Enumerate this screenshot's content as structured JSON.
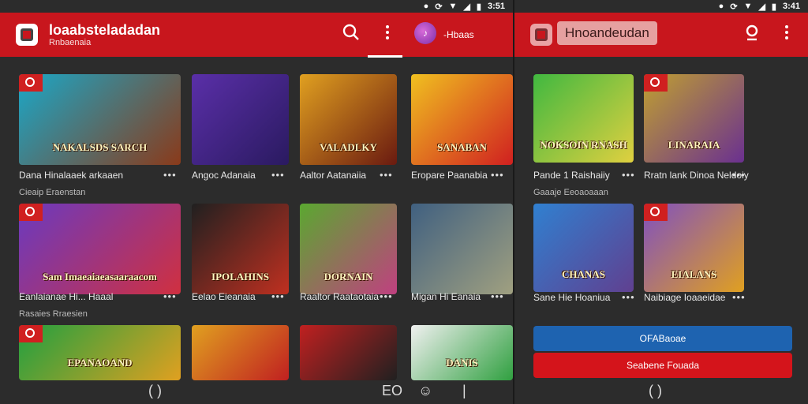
{
  "left": {
    "status": {
      "time": "3:51"
    },
    "header": {
      "title": "loaabsteladadan",
      "subtitle": "Rnbaenaia",
      "user": "-Hbaas"
    },
    "rows": [
      {
        "section": "",
        "items": [
          {
            "title": "NAKALSDS SARCH",
            "caption": "Dana Hinalaaek arkaaen",
            "g1": "#1aa8c8",
            "g2": "#8a3a1a",
            "tag": true
          },
          {
            "title": "",
            "caption": "Angoc Adanaia",
            "g1": "#5a2fa8",
            "g2": "#2a1a60",
            "tag": false
          },
          {
            "title": "VALADLKY",
            "caption": "Aaltor Aatanaiia",
            "g1": "#e0a020",
            "g2": "#6a1a10",
            "tag": false
          },
          {
            "title": "SANABAN",
            "caption": "Eropare Paanabia",
            "g1": "#f0c020",
            "g2": "#d02020",
            "tag": false
          }
        ]
      },
      {
        "section": "Cieaip Eraenstan",
        "items": [
          {
            "title": "Sam Imaeaiaeasaaraacom",
            "caption": "Eanlaianae Hi... Haaal",
            "g1": "#6a3ac0",
            "g2": "#d03040",
            "tag": true
          },
          {
            "title": "IPOLAHINS",
            "caption": "Eelao Eieanaia",
            "g1": "#202020",
            "g2": "#c03020",
            "tag": false
          },
          {
            "title": "DORNAIN",
            "caption": "Raaltor Raataotaia",
            "g1": "#5aa830",
            "g2": "#c04080",
            "tag": false
          },
          {
            "title": "",
            "caption": "Migan Hi Eanaia",
            "g1": "#406080",
            "g2": "#a0a080",
            "tag": false
          }
        ]
      },
      {
        "section": "Rasaies Rraesien",
        "items": [
          {
            "title": "EPANAOAND",
            "caption": "",
            "g1": "#20a040",
            "g2": "#e0a020",
            "tag": true
          },
          {
            "title": "",
            "caption": "",
            "g1": "#e0a020",
            "g2": "#c02020",
            "tag": false
          },
          {
            "title": "",
            "caption": "",
            "g1": "#c02020",
            "g2": "#202020",
            "tag": false
          },
          {
            "title": "DANIS",
            "caption": "",
            "g1": "#f0f0f0",
            "g2": "#30a040",
            "tag": false
          }
        ]
      }
    ]
  },
  "right": {
    "status": {
      "time": "3:41"
    },
    "header": {
      "chip": "Hnoandeudan"
    },
    "rows": [
      {
        "section": "",
        "items": [
          {
            "title": "NOKSOIN RNASH",
            "caption": "Pande 1 Raishaiiy",
            "g1": "#40b840",
            "g2": "#e0d040",
            "tag": false
          },
          {
            "title": "LINARAIA",
            "caption": "Rratn lank Dinoa Neldoiy",
            "g1": "#c0a030",
            "g2": "#6a3090",
            "tag": true
          }
        ]
      },
      {
        "section": "Gaaaje Eeoaoaaan",
        "items": [
          {
            "title": "CHANAS",
            "caption": "Sane Hie Hoaniua",
            "g1": "#3080d0",
            "g2": "#604090",
            "tag": false
          },
          {
            "title": "EIALANS",
            "caption": "Naibiage Ioaaeidae",
            "g1": "#8050c0",
            "g2": "#e0a020",
            "tag": true
          }
        ]
      }
    ],
    "buttons": {
      "primary": "OFABaoae",
      "secondary": "Seabene Fouada"
    }
  },
  "nav": {
    "home_glyph": "( )",
    "extra_glyph": "EO"
  },
  "colors": {
    "brand": "#c8161d",
    "button_blue": "#1e63b0",
    "button_red": "#d4141b"
  }
}
